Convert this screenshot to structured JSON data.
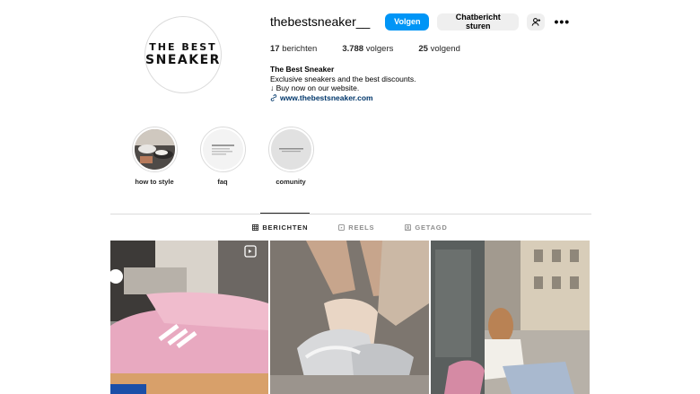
{
  "profile": {
    "avatar_line1": "THE BEST",
    "avatar_line2": "SNEAKER",
    "username": "thebestsneaker__",
    "follow_label": "Volgen",
    "message_label": "Chatbericht sturen",
    "more_icon": "more-horizontal-icon",
    "suggest_icon": "add-person-icon"
  },
  "stats": {
    "posts_count": "17",
    "posts_label": "berichten",
    "followers_count": "3.788",
    "followers_label": "volgers",
    "following_count": "25",
    "following_label": "volgend"
  },
  "bio": {
    "name": "The Best Sneaker",
    "line1": "Exclusive sneakers and the best discounts.",
    "line2": "↓ Buy now on our website.",
    "link": "www.thebestsneaker.com"
  },
  "highlights": [
    {
      "label": "how to style"
    },
    {
      "label": "faq"
    },
    {
      "label": "comunity"
    }
  ],
  "tabs": [
    {
      "label": "BERICHTEN",
      "icon": "grid-icon",
      "active": true
    },
    {
      "label": "REELS",
      "icon": "reels-icon",
      "active": false
    },
    {
      "label": "GETAGD",
      "icon": "tagged-icon",
      "active": false
    }
  ],
  "colors": {
    "accent": "#0095f6",
    "link": "#00376b"
  }
}
